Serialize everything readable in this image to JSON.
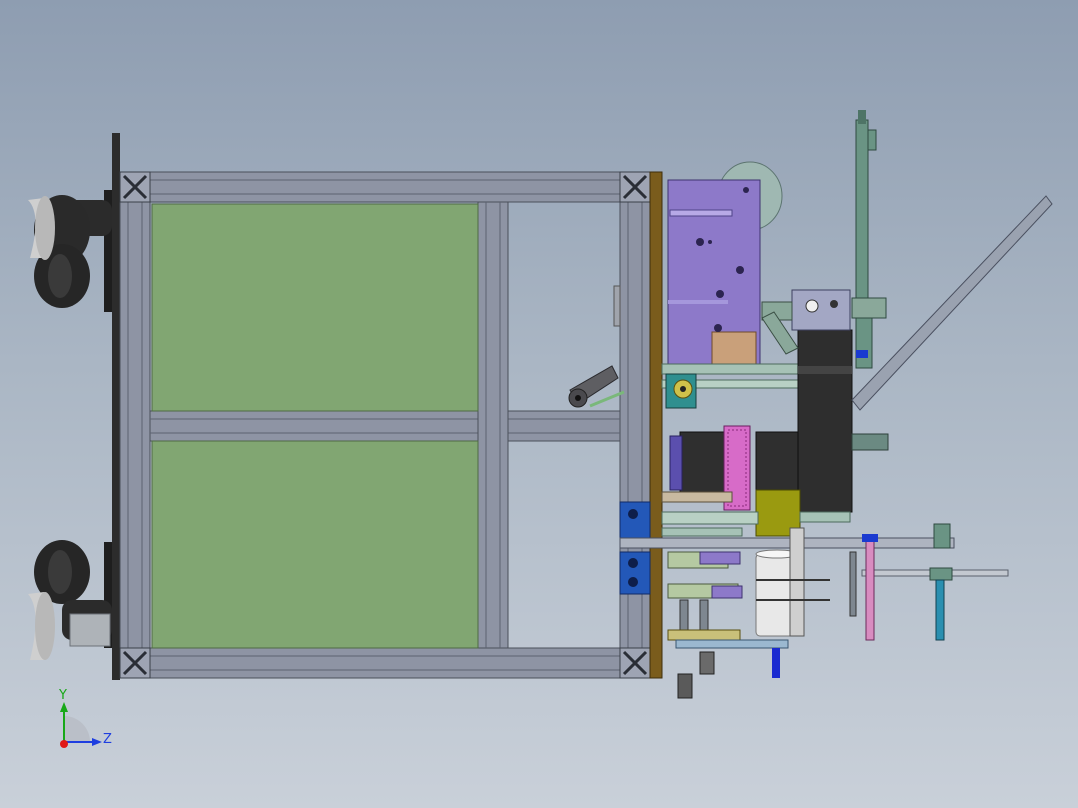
{
  "viewport": {
    "background_top": "#8e9db1",
    "background_bottom": "#c9d0d9"
  },
  "model": {
    "frame_color": "#8e94a4",
    "panel_color": "#81a672",
    "mechanism_purple": "#8d79c9",
    "motor_color": "#2e2e2e",
    "bracket_blue": "#2358b8",
    "pink_rod": "#d88cc0",
    "teal_rod": "#2a8fb0",
    "olive_block": "#9a9a10",
    "wheel_color": "#222222"
  },
  "triad": {
    "y_label": "Y",
    "z_label": "Z",
    "y_color": "#18a818",
    "z_color": "#1e3ee0",
    "x_color": "#e01818"
  }
}
